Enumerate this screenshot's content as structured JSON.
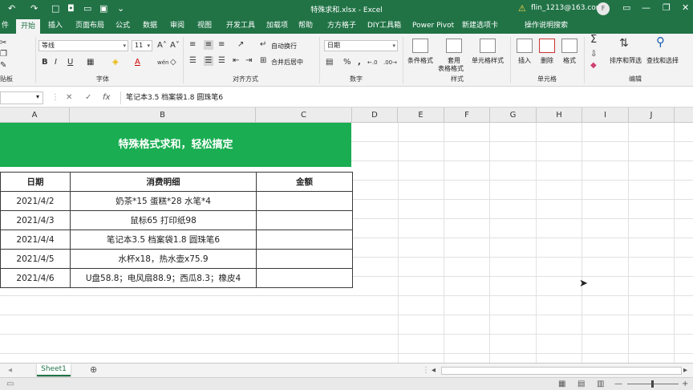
{
  "titlebar": {
    "document_title": "特殊求和.xlsx  -  Excel",
    "account": "flin_1213@163.com",
    "avatar": "F",
    "quick_access": {
      "undo": "↶",
      "redo": "↷",
      "new": "□",
      "camera": "◘",
      "open": "▭",
      "save": "▣",
      "more": "⌄"
    },
    "window_buttons": {
      "ribbon_options": "▭",
      "minimize": "—",
      "restore": "❐",
      "close": "✕"
    },
    "warn_icon": "⚠"
  },
  "tabs": [
    "件",
    "开始",
    "插入",
    "页面布局",
    "公式",
    "数据",
    "审阅",
    "视图",
    "开发工具",
    "加载项",
    "帮助",
    "方方格子",
    "DIY工具箱",
    "Power Pivot",
    "新建选项卡",
    "操作说明搜索"
  ],
  "active_tab": "开始",
  "ribbon": {
    "clipboard_label": "贴板",
    "font": {
      "name": "等线",
      "size": "11",
      "label": "字体",
      "grow": "A˄",
      "shrink": "A˅",
      "bold": "B",
      "italic": "I",
      "underline": "U",
      "wen": "wén",
      "font_color": "A",
      "clear": "◇"
    },
    "alignment": {
      "label": "对齐方式",
      "wrap": "自动换行",
      "merge": "合并后居中"
    },
    "number": {
      "format": "日期",
      "label": "数字",
      "percent": "%",
      "comma": ",",
      "inc": "←.0",
      "dec": ".00→"
    },
    "styles": {
      "label": "样式",
      "cond": "条件格式",
      "table": "套用",
      "table2": "表格格式",
      "cell": "单元格样式"
    },
    "cells": {
      "label": "单元格",
      "insert": "插入",
      "delete": "删除",
      "format": "格式"
    },
    "editing": {
      "label": "编辑",
      "sort": "排序和筛选",
      "find": "查找和选择",
      "sum": "Σ"
    }
  },
  "formula_bar": {
    "namebox_dd": "▾",
    "cancel": "✕",
    "enter": "✓",
    "fx": "fx",
    "content": "笔记本3.5 档案袋1.8 圆珠笔6"
  },
  "columns": [
    "A",
    "B",
    "C",
    "D",
    "E",
    "F",
    "G",
    "H",
    "I",
    "J"
  ],
  "banner": "特殊格式求和，轻松搞定",
  "table": {
    "headers": [
      "日期",
      "消费明细",
      "金额"
    ],
    "rows": [
      [
        "2021/4/2",
        "奶茶*15 蛋糕*28 水笔*4",
        ""
      ],
      [
        "2021/4/3",
        "鼠标65 打印纸98",
        ""
      ],
      [
        "2021/4/4",
        "笔记本3.5 档案袋1.8 圆珠笔6",
        ""
      ],
      [
        "2021/4/5",
        "水杯x18，热水壶x75.9",
        ""
      ],
      [
        "2021/4/6",
        "U盘58.8；电风扇88.9；西瓜8.3；橡皮4",
        ""
      ]
    ]
  },
  "sheetbar": {
    "sheet": "Sheet1",
    "add": "⊕",
    "nav": "◂",
    "hprev": "◂",
    "hnext": "▸"
  },
  "statusbar": {
    "view_normal": "▦",
    "view_layout": "▤",
    "view_break": "▥",
    "zoom_minus": "—",
    "zoom_plus": "+"
  },
  "colors": {
    "excel_green": "#217346",
    "banner_green": "#1aad52"
  }
}
